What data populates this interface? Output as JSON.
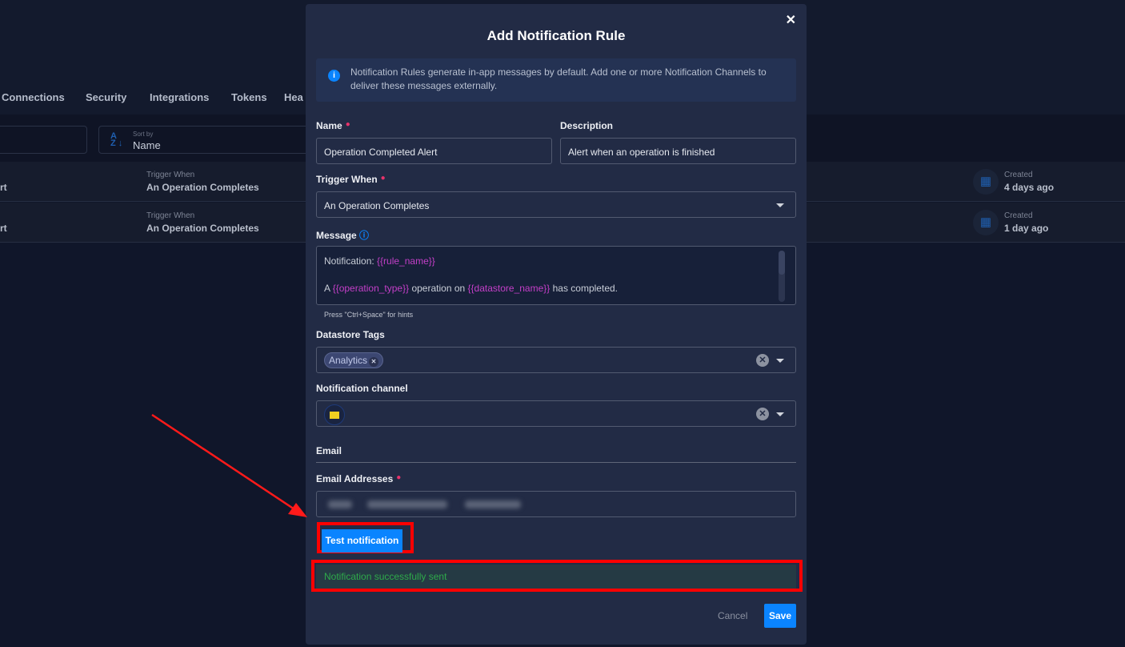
{
  "background": {
    "tabs": [
      "Connections",
      "Security",
      "Integrations",
      "Tokens",
      "Hea"
    ],
    "sort": {
      "label": "Sort by",
      "value": "Name"
    },
    "rows": [
      {
        "name": "rt",
        "trigger_label": "Trigger When",
        "trigger": "An Operation Completes",
        "created_label": "Created",
        "created": "4 days ago"
      },
      {
        "name": "rt",
        "trigger_label": "Trigger When",
        "trigger": "An Operation Completes",
        "created_label": "Created",
        "created": "1 day ago"
      }
    ]
  },
  "modal": {
    "title": "Add Notification Rule",
    "info": "Notification Rules generate in-app messages by default. Add one or more Notification Channels to deliver these messages externally.",
    "name": {
      "label": "Name",
      "value": "Operation Completed Alert"
    },
    "description": {
      "label": "Description",
      "value": "Alert when an operation is finished"
    },
    "trigger": {
      "label": "Trigger When",
      "value": "An Operation Completes"
    },
    "message": {
      "label": "Message",
      "line1_text": "Notification: ",
      "line1_var": "{{rule_name}}",
      "line2_a": "A ",
      "var_op": "{{operation_type}}",
      "line2_b": " operation on ",
      "var_ds": "{{datastore_name}}",
      "line2_c": " has completed.",
      "hint": "Press \"Ctrl+Space\" for hints"
    },
    "tags": {
      "label": "Datastore Tags",
      "values": [
        "Analytics"
      ]
    },
    "channel": {
      "label": "Notification channel",
      "icon": "mail-icon"
    },
    "email_section": "Email",
    "email_addresses": {
      "label": "Email Addresses"
    },
    "test_button": "Test notification",
    "success": "Notification successfully sent",
    "cancel": "Cancel",
    "save": "Save"
  },
  "colors": {
    "accent": "#0a84ff",
    "success": "#2eaa4a",
    "highlight": "#ff0000",
    "variable": "#c43fc8"
  }
}
